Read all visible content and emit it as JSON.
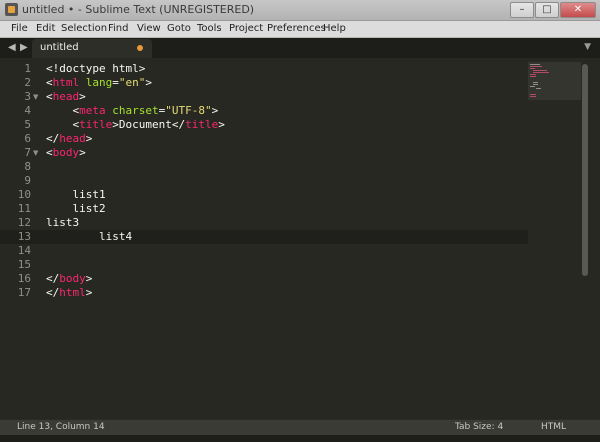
{
  "window": {
    "title": "untitled • - Sublime Text (UNREGISTERED)",
    "controls": {
      "minimize": "–",
      "maximize": "□",
      "close": "✕"
    }
  },
  "menu": [
    "File",
    "Edit",
    "Selection",
    "Find",
    "View",
    "Goto",
    "Tools",
    "Project",
    "Preferences",
    "Help"
  ],
  "tabbar": {
    "back": "◀",
    "forward": "▶",
    "tab_label": "untitled",
    "dropdown": "▼"
  },
  "editor": {
    "line_numbers": [
      "1",
      "2",
      "3",
      "4",
      "5",
      "6",
      "7",
      "8",
      "9",
      "10",
      "11",
      "12",
      "13",
      "14",
      "15",
      "16",
      "17"
    ],
    "fold_markers": {
      "l3": "▼",
      "l7": "▼"
    },
    "tokens": {
      "l1_lt": "<",
      "l1_rest": "!doctype html",
      "l1_gt": ">",
      "l2_lt": "<",
      "l2_tag": "html",
      "l2_attr": " lang",
      "l2_eq": "=",
      "l2_str": "\"en\"",
      "l2_gt": ">",
      "l3_lt": "<",
      "l3_tag": "head",
      "l3_gt": ">",
      "l4_indent": "    ",
      "l4_lt": "<",
      "l4_tag": "meta",
      "l4_attr": " charset",
      "l4_eq": "=",
      "l4_str": "\"UTF-8\"",
      "l4_gt": ">",
      "l5_indent": "    ",
      "l5_lt": "<",
      "l5_tag": "title",
      "l5_gt": ">",
      "l5_text": "Document",
      "l5_lt2": "</",
      "l5_tag2": "title",
      "l5_gt2": ">",
      "l6_lt": "</",
      "l6_tag": "head",
      "l6_gt": ">",
      "l7_lt": "<",
      "l7_tag": "body",
      "l7_gt": ">",
      "l10_text": "    list1",
      "l11_text": "    list2",
      "l12_text": "list3",
      "l13_text": "        list4",
      "l16_lt": "</",
      "l16_tag": "body",
      "l16_gt": ">",
      "l17_lt": "</",
      "l17_tag": "html",
      "l17_gt": ">"
    }
  },
  "statusbar": {
    "position": "Line 13, Column 14",
    "tab_size": "Tab Size: 4",
    "syntax": "HTML"
  },
  "colors": {
    "background": "#272822",
    "tag": "#f92672",
    "attribute": "#a6e22e",
    "string": "#e6db74",
    "text": "#f8f8f2",
    "line_number": "#8f908a",
    "tab_modified_dot": "#e69a3a"
  },
  "icons": {
    "app": "sublime-text-icon",
    "back": "arrow-left-icon",
    "forward": "arrow-right-icon",
    "fold": "fold-triangle-icon",
    "modified": "modified-dot-icon",
    "dropdown": "chevron-down-icon"
  }
}
